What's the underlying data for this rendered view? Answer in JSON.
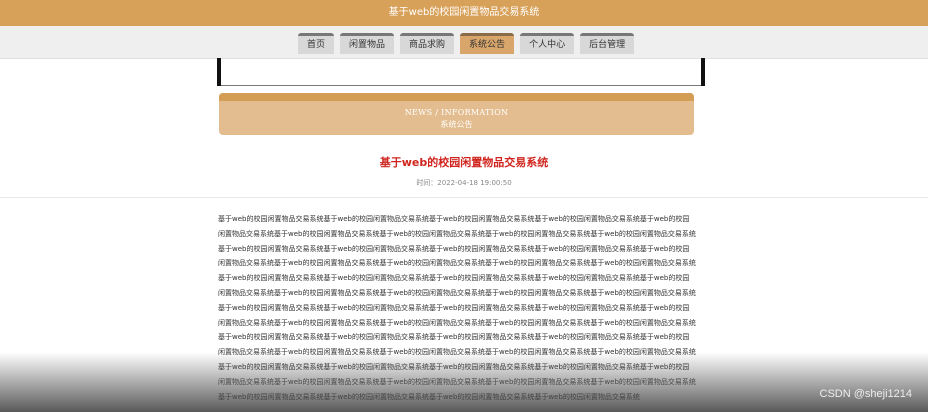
{
  "header": {
    "title": "基于web的校园闲置物品交易系统"
  },
  "nav": {
    "items": [
      "首页",
      "闲置物品",
      "商品求购",
      "系统公告",
      "个人中心",
      "后台管理"
    ],
    "active_index": 3
  },
  "banner": {
    "en": "NEWS / INFORMATION",
    "zh": "系统公告"
  },
  "article": {
    "title": "基于web的校园闲置物品交易系统",
    "time": "时间：2022-04-18 19:00:50",
    "content": "基于web的校园闲置物品交易系统基于web的校园闲置物品交易系统基于web的校园闲置物品交易系统基于web的校园闲置物品交易系统基于web的校园闲置物品交易系统基于web的校园闲置物品交易系统基于web的校园闲置物品交易系统基于web的校园闲置物品交易系统基于web的校园闲置物品交易系统基于web的校园闲置物品交易系统基于web的校园闲置物品交易系统基于web的校园闲置物品交易系统基于web的校园闲置物品交易系统基于web的校园闲置物品交易系统基于web的校园闲置物品交易系统基于web的校园闲置物品交易系统基于web的校园闲置物品交易系统基于web的校园闲置物品交易系统基于web的校园闲置物品交易系统基于web的校园闲置物品交易系统基于web的校园闲置物品交易系统基于web的校园闲置物品交易系统基于web的校园闲置物品交易系统基于web的校园闲置物品交易系统基于web的校园闲置物品交易系统基于web的校园闲置物品交易系统基于web的校园闲置物品交易系统基于web的校园闲置物品交易系统基于web的校园闲置物品交易系统基于web的校园闲置物品交易系统基于web的校园闲置物品交易系统基于web的校园闲置物品交易系统基于web的校园闲置物品交易系统基于web的校园闲置物品交易系统基于web的校园闲置物品交易系统基于web的校园闲置物品交易系统基于web的校园闲置物品交易系统基于web的校园闲置物品交易系统基于web的校园闲置物品交易系统基于web的校园闲置物品交易系统基于web的校园闲置物品交易系统基于web的校园闲置物品交易系统基于web的校园闲置物品交易系统基于web的校园闲置物品交易系统基于web的校园闲置物品交易系统基于web的校园闲置物品交易系统基于web的校园闲置物品交易系统基于web的校园闲置物品交易系统基于web的校园闲置物品交易系统基于web的校园闲置物品交易系统基于web的校园闲置物品交易系统基于web的校园闲置物品交易系统基于web的校园闲置物品交易系统基于web的校园闲置物品交易系统基于web的校园闲置物品交易系统基于web的校园闲置物品交易系统基于web的校园闲置物品交易系统基于web的校园闲置物品交易系统"
  },
  "watermark": "CSDN @sheji1214",
  "colors": {
    "header_bg": "#d8a15a",
    "active_tab": "#d8a56b",
    "banner": "#e3bd8f",
    "title_red": "#d0251e"
  }
}
